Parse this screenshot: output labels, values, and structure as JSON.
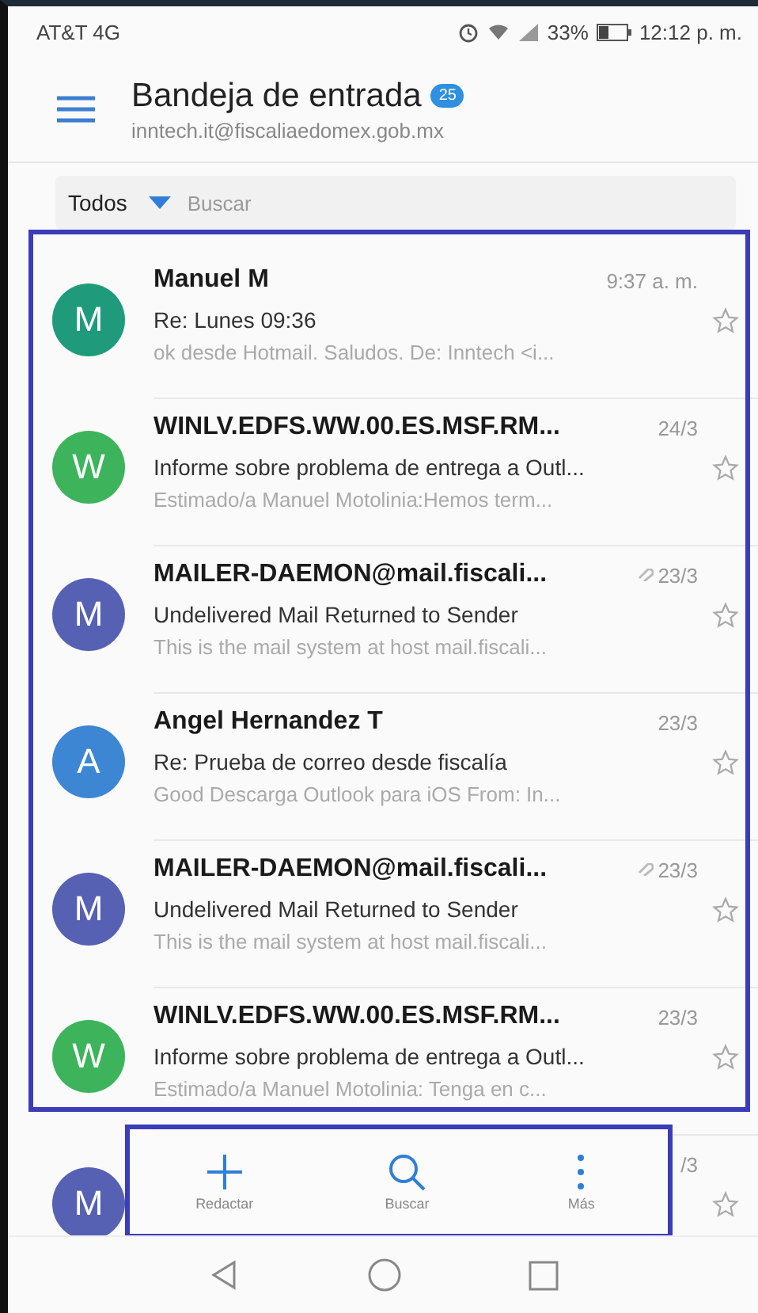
{
  "status_bar": {
    "carrier": "AT&T 4G",
    "battery": "33%",
    "time": "12:12 p. m."
  },
  "header": {
    "title": "Bandeja de entrada",
    "unread_count": "25",
    "account": "inntech.it@fiscaliaedomex.gob.mx"
  },
  "filter": {
    "label": "Todos",
    "placeholder": "Buscar"
  },
  "messages": [
    {
      "avatar": "M",
      "color": "#1f9b7b",
      "sender": "Manuel M",
      "date": "9:37 a. m.",
      "subject": "Re: Lunes 09:36",
      "preview": "ok desde Hotmail. Saludos. De: Inntech <i...",
      "attachment": false,
      "starred": false
    },
    {
      "avatar": "W",
      "color": "#3db45c",
      "sender": "WINLV.EDFS.WW.00.ES.MSF.RM...",
      "date": "24/3",
      "subject": "Informe sobre problema de entrega a Outl...",
      "preview": "Estimado/a Manuel Motolinia:Hemos term...",
      "attachment": false,
      "starred": false
    },
    {
      "avatar": "M",
      "color": "#5661b3",
      "sender": "MAILER-DAEMON@mail.fiscali...",
      "date": "23/3",
      "subject": "Undelivered Mail Returned to Sender",
      "preview": "This is the mail system at host mail.fiscali...",
      "attachment": true,
      "starred": false
    },
    {
      "avatar": "A",
      "color": "#3d86d4",
      "sender": "Angel Hernandez T",
      "date": "23/3",
      "subject": "Re: Prueba de correo desde fiscalía",
      "preview": "Good Descarga Outlook para iOS From: In...",
      "attachment": false,
      "starred": false
    },
    {
      "avatar": "M",
      "color": "#5661b3",
      "sender": "MAILER-DAEMON@mail.fiscali...",
      "date": "23/3",
      "subject": "Undelivered Mail Returned to Sender",
      "preview": "This is the mail system at host mail.fiscali...",
      "attachment": true,
      "starred": false
    },
    {
      "avatar": "W",
      "color": "#3db45c",
      "sender": "WINLV.EDFS.WW.00.ES.MSF.RM...",
      "date": "23/3",
      "subject": "Informe sobre problema de entrega a Outl...",
      "preview": "Estimado/a Manuel Motolinia: Tenga en c...",
      "attachment": false,
      "starred": false
    },
    {
      "avatar": "M",
      "color": "#5661b3",
      "date": "/3",
      "attachment": false,
      "starred": false
    }
  ],
  "toolbar": [
    {
      "kind": "compose",
      "label": "Redactar"
    },
    {
      "kind": "search",
      "label": "Buscar"
    },
    {
      "kind": "more",
      "label": "Más"
    }
  ]
}
